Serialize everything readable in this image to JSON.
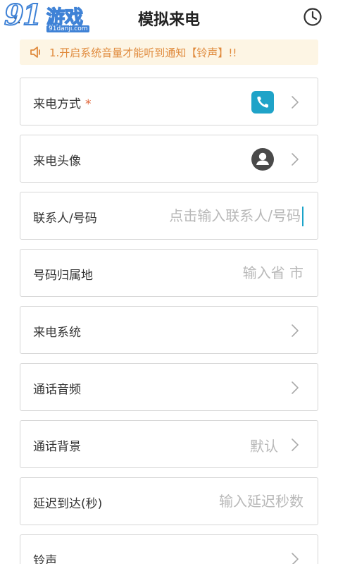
{
  "watermark": {
    "number": "91",
    "text": "游戏",
    "url": "91danji.com"
  },
  "header": {
    "title": "模拟来电",
    "back_icon": "chevron-left-icon",
    "history_icon": "clock-icon"
  },
  "notice": {
    "text": "1.开启系统音量才能听到通知【铃声】!!",
    "icon": "speaker-icon",
    "color": "#e08a3c",
    "background": "#fdf5e4"
  },
  "rows": [
    {
      "label": "来电方式",
      "required_mark": "*",
      "icon": "phone-icon"
    },
    {
      "label": "来电头像",
      "icon": "avatar-icon"
    },
    {
      "label": "联系人/号码",
      "placeholder": "点击输入联系人/号码"
    },
    {
      "label": "号码归属地",
      "placeholder": "输入省 市"
    },
    {
      "label": "来电系统"
    },
    {
      "label": "通话音频"
    },
    {
      "label": "通话背景",
      "value": "默认"
    },
    {
      "label": "延迟到达(秒)",
      "placeholder": "输入延迟秒数"
    },
    {
      "label": "铃声"
    }
  ],
  "colors": {
    "accent": "#1fa3c8",
    "required": "#e0663a",
    "border": "#d6d6d6",
    "placeholder": "#b8b8b8"
  }
}
